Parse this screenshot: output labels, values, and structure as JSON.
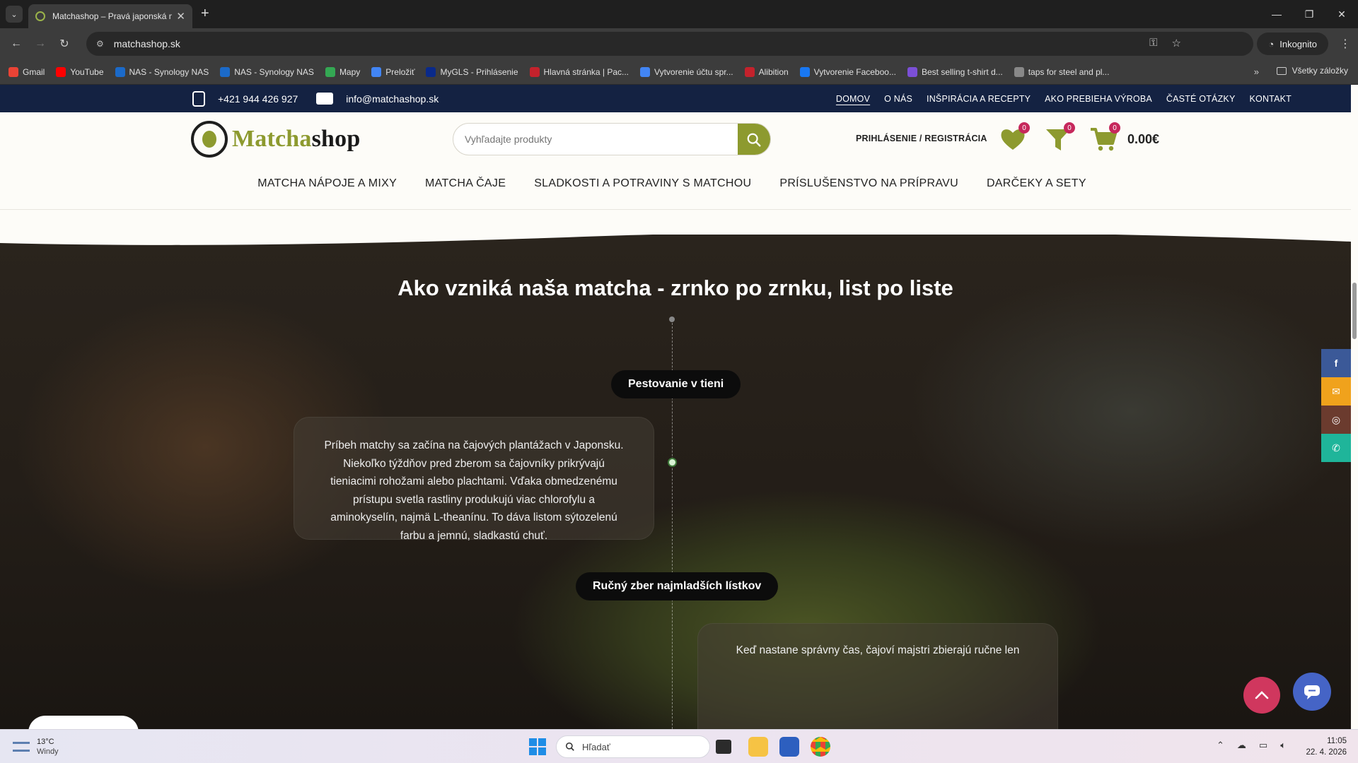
{
  "browser": {
    "tab_title": "Matchashop – Pravá japonská m",
    "url": "matchashop.sk",
    "incognito_label": "Inkognito",
    "bookmarks": [
      {
        "label": "Gmail",
        "color": "#ea4335"
      },
      {
        "label": "YouTube",
        "color": "#ff0000"
      },
      {
        "label": "NAS - Synology NAS",
        "color": "#1b6ac9"
      },
      {
        "label": "NAS - Synology NAS",
        "color": "#1b6ac9"
      },
      {
        "label": "Mapy",
        "color": "#34a853"
      },
      {
        "label": "Preložiť",
        "color": "#4285f4"
      },
      {
        "label": "MyGLS - Prihlásenie",
        "color": "#0a2a8a"
      },
      {
        "label": "Hlavná stránka | Pac...",
        "color": "#c4222c"
      },
      {
        "label": "Vytvorenie účtu spr...",
        "color": "#4285f4"
      },
      {
        "label": "Alibition",
        "color": "#c4222c"
      },
      {
        "label": "Vytvorenie Faceboo...",
        "color": "#1877f2"
      },
      {
        "label": "Best selling t-shirt d...",
        "color": "#7b4fd6"
      },
      {
        "label": "taps for steel and pl...",
        "color": "#888888"
      }
    ],
    "all_bookmarks_label": "Všetky záložky"
  },
  "site": {
    "phone": "+421 944 426 927",
    "email": "info@matchashop.sk",
    "top_nav": [
      {
        "label": "DOMOV",
        "active": true
      },
      {
        "label": "O NÁS",
        "active": false
      },
      {
        "label": "INŠPIRÁCIA A RECEPTY",
        "active": false
      },
      {
        "label": "AKO PREBIEHA VÝROBA",
        "active": false
      },
      {
        "label": "ČASTÉ OTÁZKY",
        "active": false
      },
      {
        "label": "KONTAKT",
        "active": false
      }
    ],
    "logo": {
      "part1": "Matcha",
      "part2": "shop"
    },
    "search_placeholder": "Vyhľadajte produkty",
    "account_label": "PRIHLÁSENIE / REGISTRÁCIA",
    "wishlist_count": "0",
    "compare_count": "0",
    "cart_count": "0",
    "cart_total": "0.00€",
    "main_nav": [
      "MATCHA NÁPOJE A MIXY",
      "MATCHA ČAJE",
      "SLADKOSTI A POTRAVINY S MATCHOU",
      "PRÍSLUŠENSTVO NA PRÍPRAVU",
      "DARČEKY A SETY"
    ],
    "accent_color": "#8d9a2f",
    "topbar_color": "#142242"
  },
  "hero": {
    "title": "Ako vzniká naša matcha - zrnko po zrnku, list po liste",
    "steps": [
      {
        "title": "Pestovanie v tieni",
        "text": "Príbeh matchy sa začína na čajových plantážach v Japonsku. Niekoľko týždňov pred zberom sa čajovníky prikrývajú tieniacimi rohožami alebo plachtami. Vďaka obmedzenému prístupu svetla rastliny produkujú viac chlorofylu a aminokyselín, najmä L-theanínu. To dáva listom sýtozelenú farbu a jemnú, sladkastú chuť."
      },
      {
        "title": "Ručný zber najmladších lístkov",
        "text": "Keď nastane správny čas, čajoví majstri zbierajú ručne len"
      }
    ]
  },
  "social": [
    {
      "name": "facebook",
      "glyph": "f",
      "color": "#3b5998"
    },
    {
      "name": "email",
      "glyph": "✉",
      "color": "#f0a21c"
    },
    {
      "name": "instagram",
      "glyph": "◎",
      "color": "#6b3b2e"
    },
    {
      "name": "whatsapp",
      "glyph": "✆",
      "color": "#1fb59a"
    }
  ],
  "taskbar": {
    "temperature": "13°C",
    "weather": "Windy",
    "search_placeholder": "Hľadať",
    "time": "11:05",
    "date": "22. 4. 2026"
  }
}
